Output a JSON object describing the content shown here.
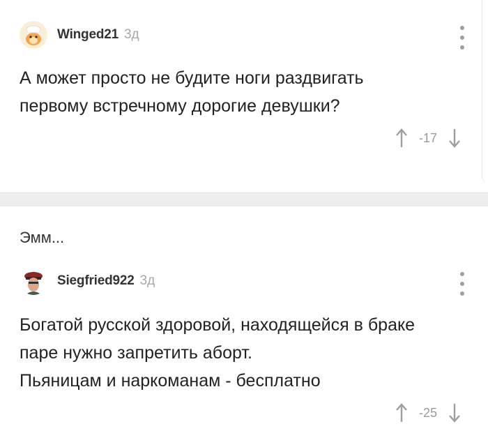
{
  "comments": [
    {
      "author": "Winged21",
      "time": "3д",
      "text_lines": [
        "А может просто не будите ноги раздвигать",
        "первому встречному дорогие девушки?"
      ],
      "rating": "-17",
      "avatar_icon": "hamster-avatar"
    },
    {
      "parent_snippet": "Эмм...",
      "author": "Siegfried922",
      "time": "3д",
      "text_lines": [
        "Богатой русской здоровой, находящейся в браке",
        "паре нужно запретить аборт.",
        "Пьяницам и наркоманам - бесплатно"
      ],
      "rating": "-25",
      "avatar_icon": "soldier-avatar"
    }
  ],
  "colors": {
    "muted": "#a8a8a8",
    "icon": "#9e9e9e",
    "separator": "#eeeeee"
  }
}
